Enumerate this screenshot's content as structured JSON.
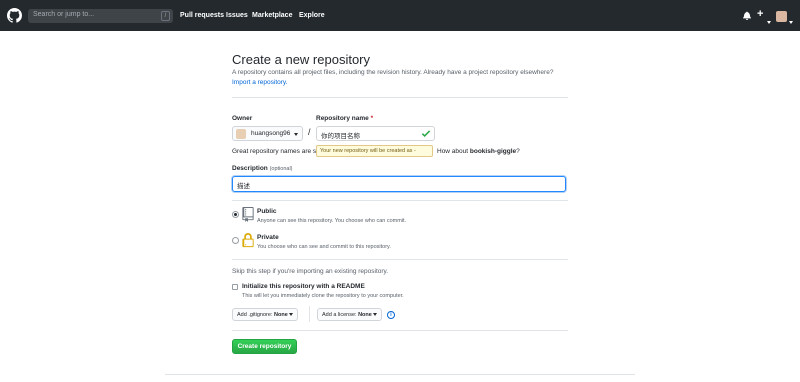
{
  "header": {
    "search_placeholder": "Search or jump to...",
    "search_shortcut": "/",
    "nav": [
      "Pull requests",
      "Issues",
      "Marketplace",
      "Explore"
    ],
    "icons": [
      "github-logo-icon",
      "bell-icon",
      "plus-icon",
      "avatar"
    ],
    "background": "#24292e"
  },
  "page": {
    "title": "Create a new repository",
    "subtitle": "A repository contains all project files, including the revision history. Already have a project repository elsewhere?",
    "import_link": "Import a repository."
  },
  "form": {
    "owner_label": "Owner",
    "owner_value": "huangsong96",
    "separator": "/",
    "repo_label": "Repository name",
    "repo_required": "*",
    "repo_value": "你的项目名称",
    "tooltip": "Your new repository will be created as -",
    "great_left": "Great repository names are s",
    "great_right_prefix": "How about ",
    "great_suggestion": "bookish-giggle",
    "great_suffix": "?",
    "description_label": "Description",
    "description_optional": "(optional)",
    "description_value": "描述"
  },
  "visibility": {
    "public_title": "Public",
    "public_desc": "Anyone can see this repository. You choose who can commit.",
    "private_title": "Private",
    "private_desc": "You choose who can see and commit to this repository.",
    "selected": "public"
  },
  "init": {
    "skip_text": "Skip this step if you're importing an existing repository.",
    "readme_title": "Initialize this repository with a README",
    "readme_desc": "This will let you immediately clone the repository to your computer.",
    "readme_checked": false,
    "gitignore_label": "Add .gitignore: ",
    "gitignore_value": "None",
    "license_label": "Add a license: ",
    "license_value": "None",
    "info_icon": "i"
  },
  "actions": {
    "create_label": "Create repository",
    "create_color": "#2cbe4e"
  }
}
